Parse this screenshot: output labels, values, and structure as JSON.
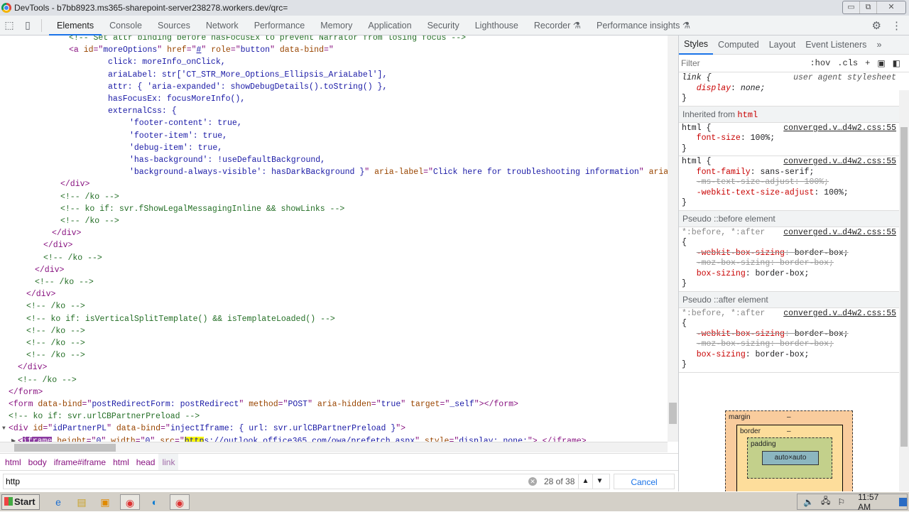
{
  "window": {
    "title": "DevTools - b7bb8923.ms365-sharepoint-server238278.workers.dev/qrc=",
    "controls": [
      "▭",
      "⧉",
      "✕"
    ]
  },
  "toolbar": {
    "tabs": [
      "Elements",
      "Console",
      "Sources",
      "Network",
      "Performance",
      "Memory",
      "Application",
      "Security",
      "Lighthouse",
      "Recorder ⚗",
      "Performance insights ⚗"
    ],
    "active": 0
  },
  "code_lines": [
    {
      "indent": 97,
      "segs": [
        [
          "cm",
          "<!-- Set attr binding before hasFocusEx to prevent Narrator from losing focus -->"
        ]
      ]
    },
    {
      "indent": 97,
      "segs": [
        [
          "tag",
          "<a "
        ],
        [
          "an",
          "id"
        ],
        [
          "tag",
          "=\""
        ],
        [
          "av",
          "moreOptions"
        ],
        [
          "tag",
          "\" "
        ],
        [
          "an",
          "href"
        ],
        [
          "tag",
          "=\""
        ],
        [
          "lnk",
          "#"
        ],
        [
          "tag",
          "\" "
        ],
        [
          "an",
          "role"
        ],
        [
          "tag",
          "=\""
        ],
        [
          "av",
          "button"
        ],
        [
          "tag",
          "\" "
        ],
        [
          "an",
          "data-bind"
        ],
        [
          "tag",
          "=\""
        ]
      ]
    },
    {
      "indent": 152,
      "segs": [
        [
          "av",
          "click: moreInfo_onClick,"
        ]
      ]
    },
    {
      "indent": 152,
      "segs": [
        [
          "av",
          "ariaLabel: str['CT_STR_More_Options_Ellipsis_AriaLabel'],"
        ]
      ]
    },
    {
      "indent": 152,
      "segs": [
        [
          "av",
          "attr: { 'aria-expanded': showDebugDetails().toString() },"
        ]
      ]
    },
    {
      "indent": 152,
      "segs": [
        [
          "av",
          "hasFocusEx: focusMoreInfo(),"
        ]
      ]
    },
    {
      "indent": 152,
      "segs": [
        [
          "av",
          "externalCss: {"
        ]
      ]
    },
    {
      "indent": 182,
      "segs": [
        [
          "av",
          "'footer-content': true,"
        ]
      ]
    },
    {
      "indent": 182,
      "segs": [
        [
          "av",
          "'footer-item': true,"
        ]
      ]
    },
    {
      "indent": 182,
      "segs": [
        [
          "av",
          "'debug-item': true,"
        ]
      ]
    },
    {
      "indent": 182,
      "segs": [
        [
          "av",
          "'has-background': !useDefaultBackground,"
        ]
      ]
    },
    {
      "indent": 182,
      "segs": [
        [
          "av",
          "'background-always-visible': hasDarkBackground }"
        ],
        [
          "tag",
          "\" "
        ],
        [
          "an",
          "aria-label"
        ],
        [
          "tag",
          "=\""
        ],
        [
          "av",
          "Click here for troubleshooting information"
        ],
        [
          "tag",
          "\" "
        ],
        [
          "an",
          "aria"
        ]
      ]
    },
    {
      "indent": 85,
      "segs": [
        [
          "tag",
          "</div>"
        ]
      ]
    },
    {
      "indent": 85,
      "segs": [
        [
          "cm",
          "<!-- /ko -->"
        ]
      ]
    },
    {
      "indent": 85,
      "segs": [
        [
          "cm",
          "<!-- ko if: svr.fShowLegalMessagingInline && showLinks -->"
        ]
      ]
    },
    {
      "indent": 85,
      "segs": [
        [
          "cm",
          "<!-- /ko -->"
        ]
      ]
    },
    {
      "indent": 73,
      "segs": [
        [
          "tag",
          "</div>"
        ]
      ]
    },
    {
      "indent": 61,
      "segs": [
        [
          "tag",
          "</div>"
        ]
      ]
    },
    {
      "indent": 61,
      "segs": [
        [
          "cm",
          "<!-- /ko -->"
        ]
      ]
    },
    {
      "indent": 49,
      "segs": [
        [
          "tag",
          "</div>"
        ]
      ]
    },
    {
      "indent": 49,
      "segs": [
        [
          "cm",
          "<!-- /ko -->"
        ]
      ]
    },
    {
      "indent": 37,
      "segs": [
        [
          "tag",
          "</div>"
        ]
      ]
    },
    {
      "indent": 37,
      "segs": [
        [
          "cm",
          "<!-- /ko -->"
        ]
      ]
    },
    {
      "indent": 37,
      "segs": [
        [
          "cm",
          "<!-- ko if: isVerticalSplitTemplate() && isTemplateLoaded() -->"
        ]
      ]
    },
    {
      "indent": 37,
      "segs": [
        [
          "cm",
          "<!-- /ko -->"
        ]
      ]
    },
    {
      "indent": 37,
      "segs": [
        [
          "cm",
          "<!-- /ko -->"
        ]
      ]
    },
    {
      "indent": 37,
      "segs": [
        [
          "cm",
          "<!-- /ko -->"
        ]
      ]
    },
    {
      "indent": 25,
      "segs": [
        [
          "tag",
          "</div>"
        ]
      ]
    },
    {
      "indent": 25,
      "segs": [
        [
          "cm",
          "<!-- /ko -->"
        ]
      ]
    },
    {
      "indent": 12,
      "segs": [
        [
          "tag",
          "</form>"
        ]
      ]
    },
    {
      "indent": 12,
      "segs": [
        [
          "tag",
          "<form "
        ],
        [
          "an",
          "data-bind"
        ],
        [
          "tag",
          "=\""
        ],
        [
          "av",
          "postRedirectForm: postRedirect"
        ],
        [
          "tag",
          "\" "
        ],
        [
          "an",
          "method"
        ],
        [
          "tag",
          "=\""
        ],
        [
          "av",
          "POST"
        ],
        [
          "tag",
          "\" "
        ],
        [
          "an",
          "aria-hidden"
        ],
        [
          "tag",
          "=\""
        ],
        [
          "av",
          "true"
        ],
        [
          "tag",
          "\" "
        ],
        [
          "an",
          "target"
        ],
        [
          "tag",
          "=\""
        ],
        [
          "av",
          "_self"
        ],
        [
          "tag",
          "\"></form>"
        ]
      ]
    },
    {
      "indent": 12,
      "segs": [
        [
          "cm",
          "<!-- ko if: svr.urlCBPartnerPreload -->"
        ]
      ]
    },
    {
      "indent": 12,
      "tri": "▼",
      "segs": [
        [
          "tag",
          "<div "
        ],
        [
          "an",
          "id"
        ],
        [
          "tag",
          "=\""
        ],
        [
          "av",
          "idPartnerPL"
        ],
        [
          "tag",
          "\" "
        ],
        [
          "an",
          "data-bind"
        ],
        [
          "tag",
          "=\""
        ],
        [
          "av",
          "injectIframe: { url: svr.urlCBPartnerPreload }"
        ],
        [
          "tag",
          "\">"
        ]
      ]
    },
    {
      "indent": 25,
      "tri": "▶",
      "segs": [
        [
          "tag",
          "<"
        ],
        [
          "hl-purple",
          "iframe"
        ],
        [
          "an",
          " height"
        ],
        [
          "tag",
          "=\""
        ],
        [
          "av",
          "0"
        ],
        [
          "tag",
          "\" "
        ],
        [
          "an",
          "width"
        ],
        [
          "tag",
          "=\""
        ],
        [
          "av",
          "0"
        ],
        [
          "tag",
          "\" "
        ],
        [
          "an",
          "src"
        ],
        [
          "tag",
          "=\""
        ],
        [
          "lnk hl-yellow",
          "http"
        ],
        [
          "lnk",
          "s://outlook.office365.com/owa/prefetch.aspx"
        ],
        [
          "tag",
          "\" "
        ],
        [
          "an",
          "style"
        ],
        [
          "tag",
          "=\""
        ],
        [
          "av",
          "display: none;"
        ],
        [
          "tag",
          "\">…</iframe>"
        ]
      ]
    }
  ],
  "breadcrumb": [
    "html",
    "body",
    "iframe#iframe",
    "html",
    "head",
    "link"
  ],
  "search": {
    "value": "http",
    "count": "28 of 38",
    "cancel": "Cancel",
    "clear": "✕"
  },
  "styles": {
    "tabs": [
      "Styles",
      "Computed",
      "Layout",
      "Event Listeners",
      "»"
    ],
    "filter_placeholder": "Filter",
    "hov": ":hov",
    "cls": ".cls",
    "plus": "+",
    "rule1": {
      "selector": "link {",
      "source": "user agent stylesheet",
      "prop": "display",
      "val": " none;",
      "close": "}"
    },
    "inherited": {
      "label": "Inherited from ",
      "tag": "html"
    },
    "rule2": {
      "selector": "html {",
      "source": "converged.v…d4w2.css:55",
      "prop": "font-size",
      "val": " 100%;",
      "close": "}"
    },
    "rule3": {
      "selector": "html {",
      "source": "converged.v…d4w2.css:55",
      "p1": "font-family",
      "v1": " sans-serif;",
      "p2": "-ms-text-size-adjust",
      "v2": " 100%;",
      "p3": "-webkit-text-size-adjust",
      "v3": " 100%;",
      "close": "}"
    },
    "before": {
      "label": "Pseudo ::before element",
      "selector": "*:before, *:after",
      "source": "converged.v…d4w2.css:55",
      "open": "{",
      "p1": "-webkit-box-sizing",
      "v1": " border-box;",
      "p2": "-moz-box-sizing",
      "v2": " border-box;",
      "p3": "box-sizing",
      "v3": " border-box;",
      "close": "}"
    },
    "after": {
      "label": "Pseudo ::after element",
      "selector": "*:before, *:after",
      "source": "converged.v…d4w2.css:55",
      "open": "{",
      "p1": "-webkit-box-sizing",
      "v1": " border-box;",
      "p2": "-moz-box-sizing",
      "v2": " border-box;",
      "p3": "box-sizing",
      "v3": " border-box;",
      "close": "}"
    },
    "boxmodel": {
      "margin": "margin",
      "border": "border",
      "padding": "padding",
      "content": "auto×auto",
      "dash": "–"
    }
  },
  "taskbar": {
    "start": "Start",
    "clock": "11:57 AM"
  }
}
